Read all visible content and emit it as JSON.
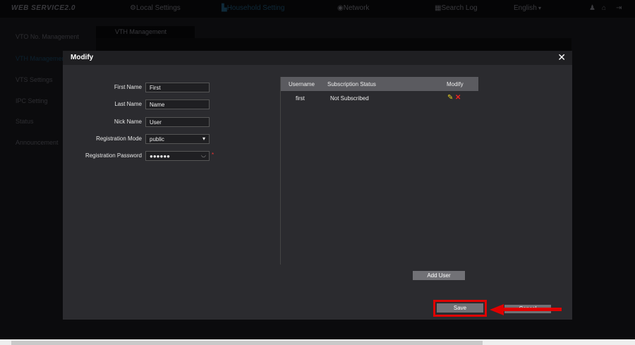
{
  "topbar": {
    "logo": "WEB SERVICE2.0",
    "nav": [
      "Local Settings",
      "Household Setting",
      "Network",
      "Search Log"
    ],
    "language": "English"
  },
  "sidebar": [
    "VTO No. Management",
    "VTH Management",
    "VTS Settings",
    "IPC Setting",
    "Status",
    "Announcement"
  ],
  "tab": "VTH Management",
  "modal": {
    "title": "Modify",
    "fields": [
      {
        "label": "First Name",
        "value": "First"
      },
      {
        "label": "Last Name",
        "value": "Name"
      },
      {
        "label": "Nick Name",
        "value": "User"
      },
      {
        "label": "Registration Mode",
        "value": "public"
      },
      {
        "label": "Registration Password",
        "value": "●●●●●●"
      }
    ],
    "required_mark": "*",
    "table": {
      "headers": [
        "Username",
        "Subscription Status",
        "Modify"
      ],
      "rows": [
        {
          "username": "first",
          "status": "Not Subscribed"
        }
      ]
    },
    "add_user": "Add User",
    "save": "Save",
    "cancel": "Cancel"
  },
  "colors": {
    "highlight": "#e00000",
    "accent": "#1d6fa5"
  }
}
